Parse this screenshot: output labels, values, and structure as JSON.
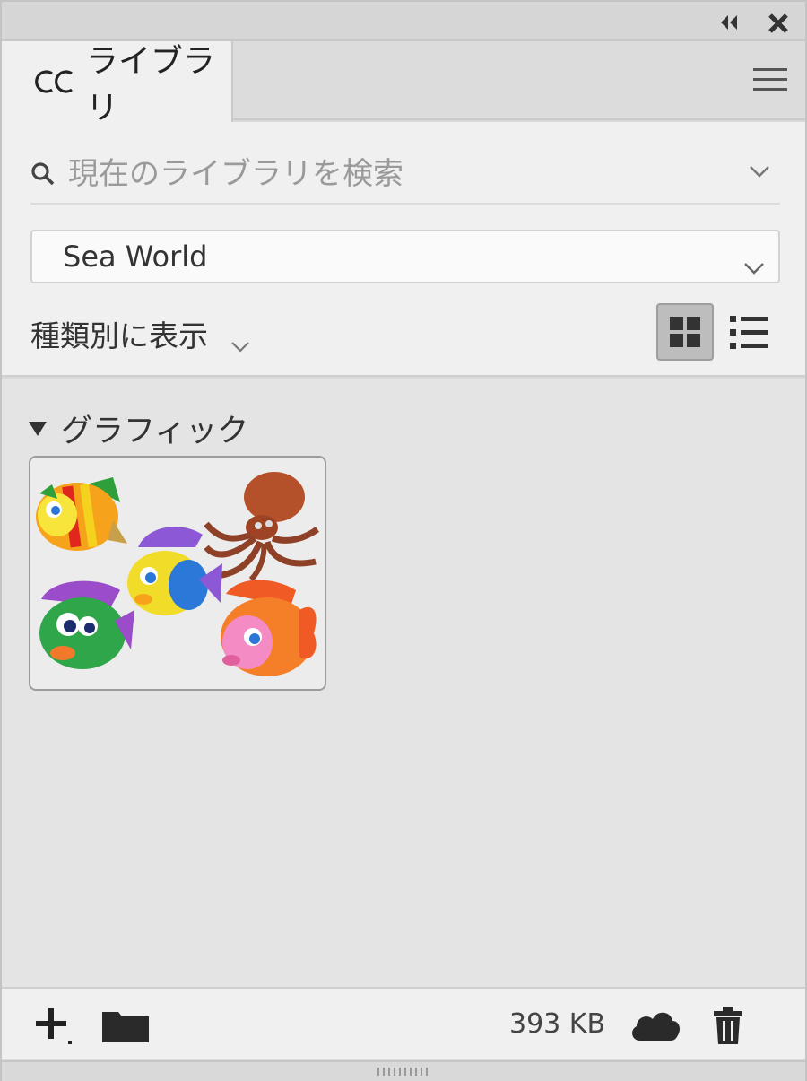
{
  "window": {
    "collapse_icon": "double-chevron-left-icon",
    "close_icon": "close-icon"
  },
  "tab": {
    "label": "ライブラリ",
    "logo_text": "CC",
    "menu_icon": "hamburger-menu-icon"
  },
  "search": {
    "placeholder": "現在のライブラリを検索",
    "value": ""
  },
  "library_select": {
    "selected": "Sea World"
  },
  "view_by": {
    "label": "種類別に表示",
    "modes": [
      "grid",
      "list"
    ],
    "active_mode": "grid"
  },
  "section": {
    "title": "グラフィック",
    "expanded": true
  },
  "footer": {
    "size": "393 KB",
    "add_icon": "plus-icon",
    "folder_icon": "folder-icon",
    "cloud_icon": "cloud-icon",
    "trash_icon": "trash-icon"
  },
  "colors": {
    "panel_bg": "#e4e4e4",
    "controls_bg": "#f0f0f0",
    "icon_dark": "#333333"
  }
}
